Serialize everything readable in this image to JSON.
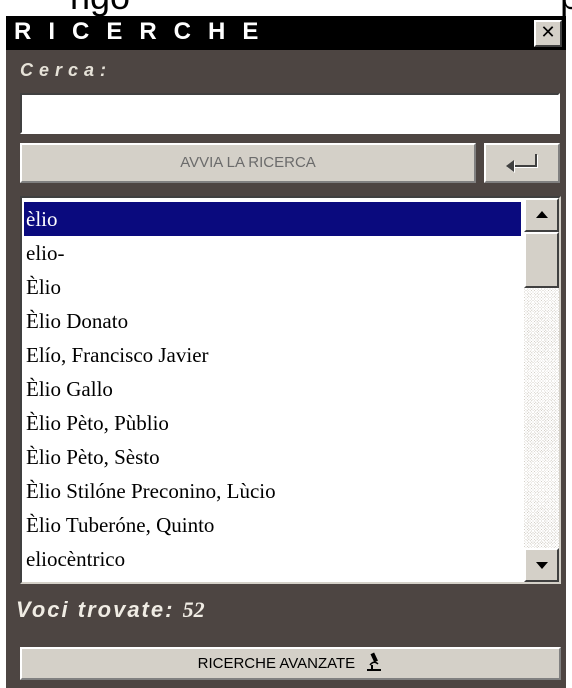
{
  "top_fragment": "ngo        ...        p",
  "window": {
    "title": "RICERCHE",
    "close_glyph": "✕"
  },
  "search": {
    "label": "Cerca:",
    "value": "",
    "start_button_label": "AVVIA LA RICERCA",
    "enter_icon": "enter-arrow-icon"
  },
  "results": {
    "items": [
      "èlio",
      "elio-",
      "Èlio",
      "Èlio Donato",
      "Elío, Francisco Javier",
      "Èlio Gallo",
      "Èlio Pèto, Pùblio",
      "Èlio Pèto, Sèsto",
      "Èlio Stilóne Preconino, Lùcio",
      "Èlio Tuberóne, Quinto",
      "eliocèntrico"
    ],
    "selected_index": 0,
    "scroll_position": 0.0
  },
  "footer": {
    "found_label": "Voci trovate:",
    "found_count": "52",
    "advanced_button_label": "RICERCHE AVANZATE",
    "advanced_icon": "microscope-icon"
  },
  "colors": {
    "panel_bg": "#4d4542",
    "titlebar_bg": "#000000",
    "selection_bg": "#0a0a7e",
    "button_face": "#d4d0c8"
  }
}
